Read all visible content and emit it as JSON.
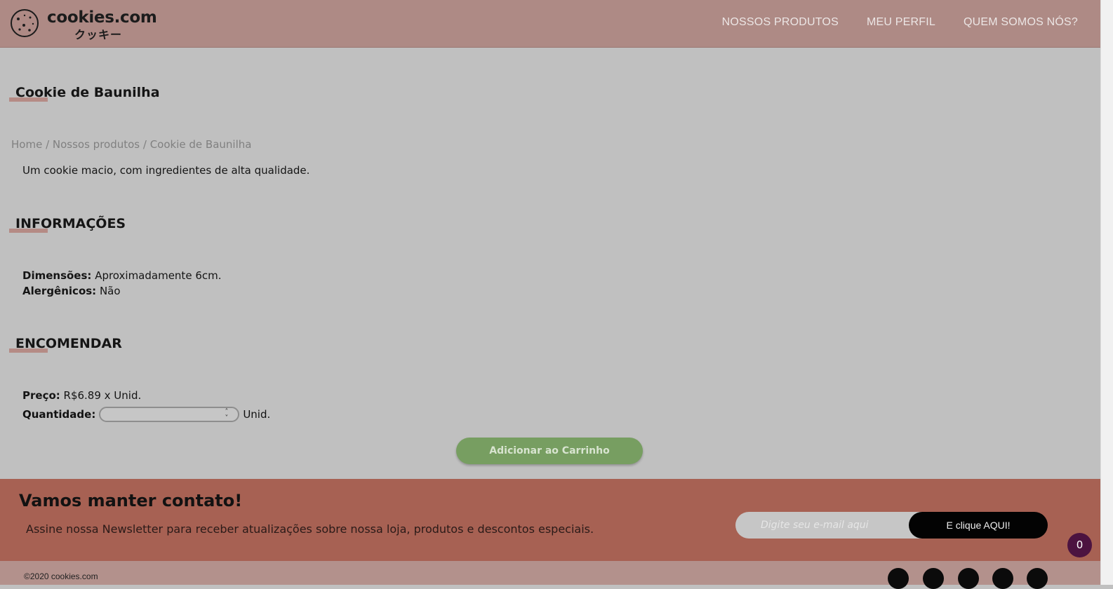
{
  "header": {
    "brand": "cookies.com",
    "brand_sub": "クッキー",
    "nav": [
      "NOSSOS PRODUTOS",
      "MEU PERFIL",
      "QUEM SOMOS NÓS?"
    ]
  },
  "product": {
    "title": "Cookie de Baunilha",
    "breadcrumb": "Home / Nossos produtos / Cookie de Baunilha",
    "description": "Um cookie macio, com ingredientes de alta qualidade."
  },
  "info": {
    "title": "INFORMAÇÕES",
    "dimensions_label": "Dimensões:",
    "dimensions_value": " Aproximadamente 6cm.",
    "allergens_label": "Alergênicos:",
    "allergens_value": " Não"
  },
  "order": {
    "title": "ENCOMENDAR",
    "price_label": "Preço:",
    "price_value": " R$6.89 x Unid.",
    "quantity_label": "Quantidade:",
    "quantity_unit": "Unid.",
    "add_button": "Adicionar ao Carrinho"
  },
  "newsletter": {
    "title": "Vamos manter contato!",
    "subtitle": "Assine nossa Newsletter para receber atualizações sobre nossa loja, produtos e descontos especiais.",
    "email_placeholder": "Digite seu e-mail aqui",
    "button": "E clique AQUI!"
  },
  "cart_count": "0",
  "footer": {
    "copyright": "©2020 cookies.com",
    "social_icons": [
      "instagram-icon",
      "facebook-icon",
      "youtube-icon",
      "whatsapp-icon",
      "twitter-icon"
    ]
  },
  "colors": {
    "header": "#ae8a85",
    "accent_underline": "#b58b85",
    "add_button": "#779e61",
    "newsletter_bg": "#a76153",
    "cart_badge": "#4c1340"
  }
}
